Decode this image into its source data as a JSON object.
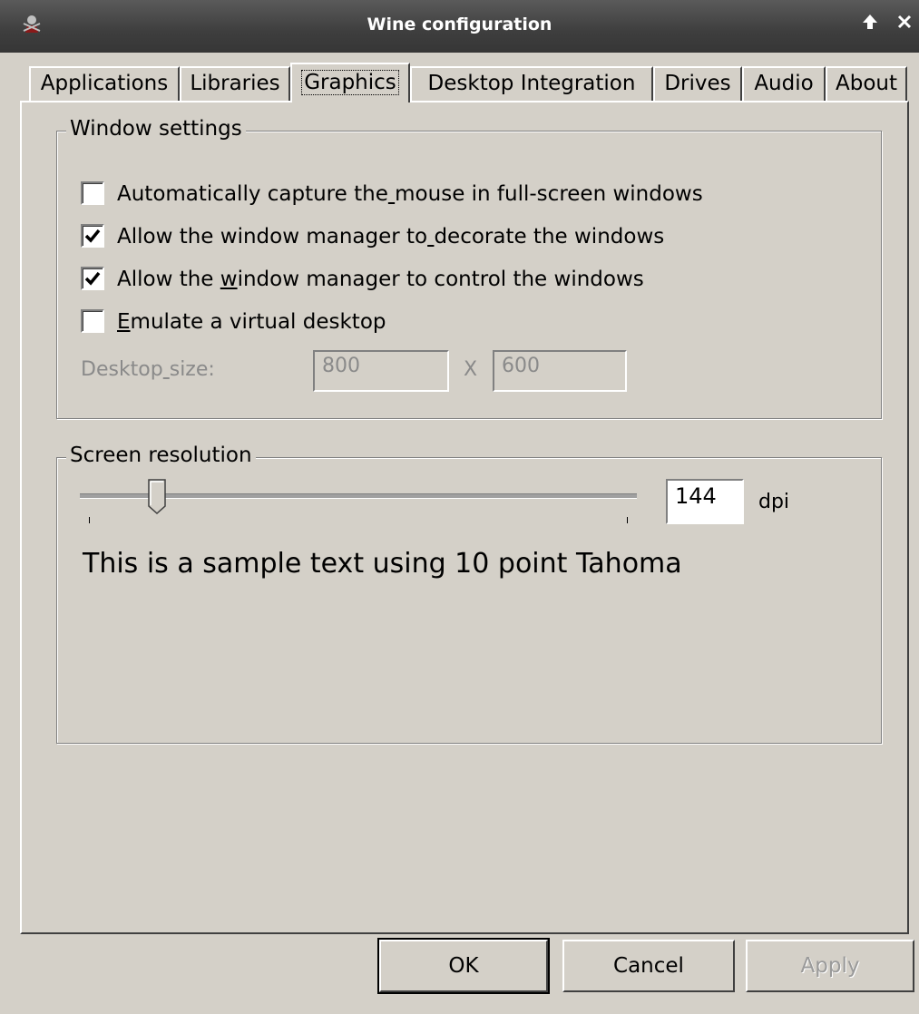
{
  "window": {
    "title": "Wine configuration",
    "up_icon": "arrow-up-icon",
    "close_icon": "close-icon"
  },
  "tabs": [
    {
      "label": "Applications",
      "active": false
    },
    {
      "label": "Libraries",
      "active": false
    },
    {
      "label": "Graphics",
      "active": true
    },
    {
      "label": "Desktop Integration",
      "active": false
    },
    {
      "label": "Drives",
      "active": false
    },
    {
      "label": "Audio",
      "active": false
    },
    {
      "label": "About",
      "active": false
    }
  ],
  "window_settings": {
    "title": "Window settings",
    "options": [
      {
        "pre": "Automatically capture the",
        "mnemonic": " ",
        "post": "mouse in full-screen windows",
        "checked": false
      },
      {
        "pre": "Allow the window manager to",
        "mnemonic": " ",
        "post": "decorate the windows",
        "checked": true
      },
      {
        "pre": "Allow the ",
        "mnemonic": "w",
        "post": "indow manager to control the windows",
        "checked": true
      },
      {
        "pre": "",
        "mnemonic": "E",
        "post": "mulate a virtual desktop",
        "checked": false
      }
    ],
    "desktop_size": {
      "label_pre": "Desktop",
      "label_mnemonic": " ",
      "label_post": "size:",
      "width": "800",
      "separator": "X",
      "height": "600"
    }
  },
  "screen_resolution": {
    "title": "Screen resolution",
    "dpi_value": "144",
    "dpi_unit": "dpi",
    "sample_text": "This is a sample text using 10 point Tahoma"
  },
  "buttons": {
    "ok": "OK",
    "cancel": "Cancel",
    "apply": "Apply"
  },
  "colors": {
    "face": "#d4d0c8",
    "titlebar": "#3e3e3e"
  }
}
